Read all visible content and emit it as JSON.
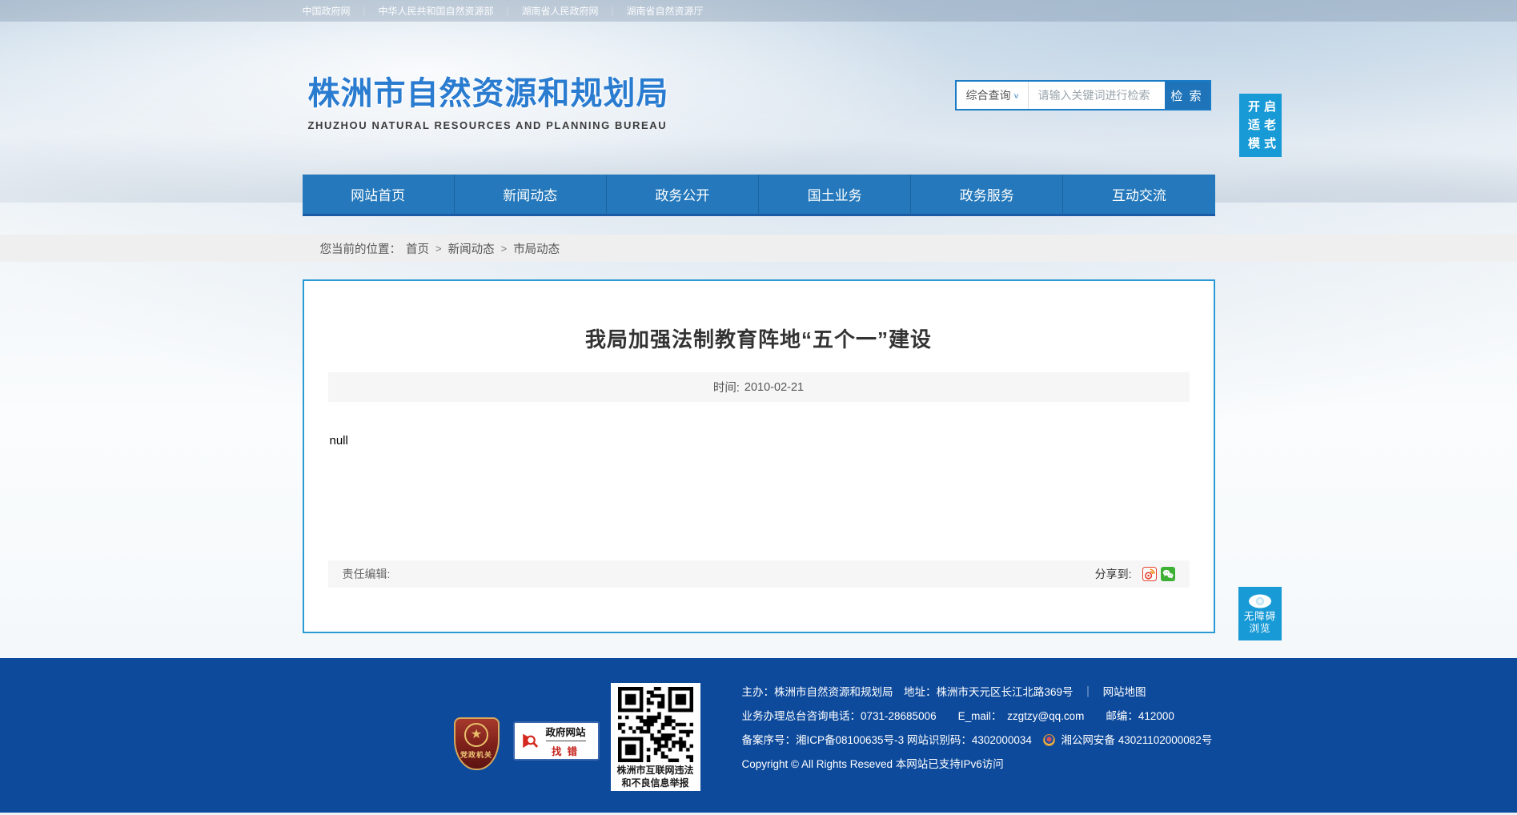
{
  "topbar": {
    "separator": "｜",
    "links": [
      "中国政府网",
      "中华人民共和国自然资源部",
      "湖南省人民政府网",
      "湖南省自然资源厅"
    ]
  },
  "header": {
    "site_title": "株洲市自然资源和规划局",
    "site_subtitle": "ZHUZHOU NATURAL RESOURCES AND PLANNING BUREAU",
    "search": {
      "category": "综合查询",
      "dropdown_arrow": "∨",
      "placeholder": "请输入关键词进行检索",
      "button_label": "检 索"
    }
  },
  "floating": {
    "elder_mode": "开启适老模式",
    "accessibility": "无障碍浏览"
  },
  "nav": {
    "items": [
      "网站首页",
      "新闻动态",
      "政务公开",
      "国土业务",
      "政务服务",
      "互动交流"
    ]
  },
  "breadcrumb": {
    "label": "您当前的位置：",
    "separator": ">",
    "items": [
      "首页",
      "新闻动态",
      "市局动态"
    ]
  },
  "article": {
    "title": "我局加强法制教育阵地“五个一”建设",
    "date_label": "时间:",
    "date": "2010-02-21",
    "body": "null",
    "editor_label": "责任编辑:",
    "share_label": "分享到:"
  },
  "share_icons": [
    "weibo",
    "wechat"
  ],
  "footer": {
    "party_badge_label": "党政机关",
    "party_badge_star": "★",
    "error_badge": {
      "line1": "政府网站",
      "line2": "找错"
    },
    "qr_caption_line1": "株洲市互联网违法",
    "qr_caption_line2": "和不良信息举报",
    "line1_text": "主办：株洲市自然资源和规划局　地址：株洲市天元区长江北路369号",
    "line1_sep": "｜",
    "line1_link": "网站地图",
    "line2_text": "业务办理总台咨询电话：0731-28685006　　E_mail：　zzgtzy@qq.com　　邮编：412000",
    "line3_text": "备案序号：湘ICP备08100635号-3 网站识别码：4302000034",
    "line3_link": "湘公网安备 43021102000082号",
    "line4_text": "Copyright © All Rights Reseved 本网站已支持IPv6访问",
    "footer_color": "#0d4a9c",
    "accent_color": "#2478bb"
  }
}
